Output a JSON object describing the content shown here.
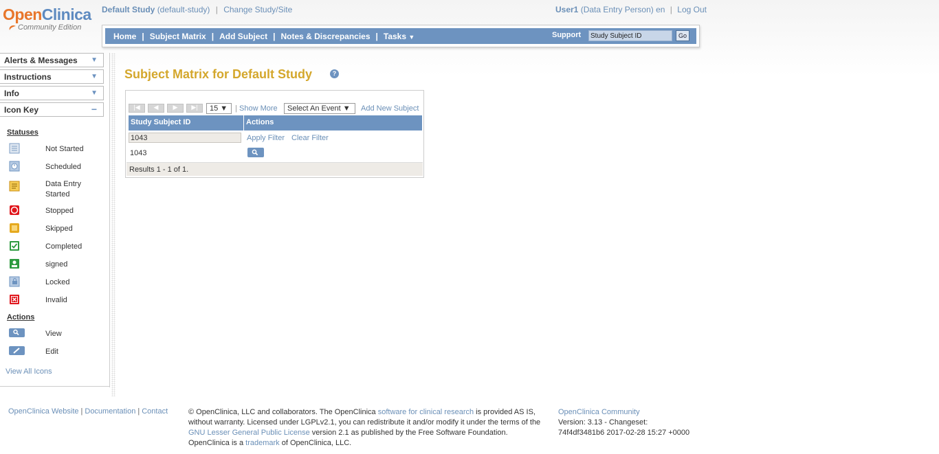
{
  "logo": {
    "part1": "Open",
    "part2": "Clinica",
    "edition": "Community Edition"
  },
  "study": {
    "name": "Default Study",
    "id": "(default-study)",
    "sep": "|",
    "change_link": "Change Study/Site"
  },
  "user": {
    "name": "User1",
    "role": "(Data Entry Person)",
    "lang": "en",
    "sep": "|",
    "logout": "Log Out"
  },
  "nav": {
    "items": [
      "Home",
      "Subject Matrix",
      "Add Subject",
      "Notes & Discrepancies",
      "Tasks"
    ],
    "sep": "|",
    "tasks_caret": "▼",
    "support": "Support",
    "search_value": "Study Subject ID",
    "go_label": "Go"
  },
  "sidebar": {
    "panels": [
      {
        "label": "Alerts & Messages",
        "state": "▼"
      },
      {
        "label": "Instructions",
        "state": "▼"
      },
      {
        "label": "Info",
        "state": "▼"
      },
      {
        "label": "Icon Key",
        "state": "−"
      }
    ],
    "statuses_heading": "Statuses",
    "statuses": [
      {
        "label": "Not Started",
        "icon": "not-started-icon",
        "color": "#7c9cc4"
      },
      {
        "label": "Scheduled",
        "icon": "scheduled-icon",
        "color": "#6d93c0"
      },
      {
        "label": "Data Entry Started",
        "icon": "data-entry-started-icon",
        "color": "#e5a91f"
      },
      {
        "label": "Stopped",
        "icon": "stopped-icon",
        "color": "#e0161c"
      },
      {
        "label": "Skipped",
        "icon": "skipped-icon",
        "color": "#e5a91f"
      },
      {
        "label": "Completed",
        "icon": "completed-icon",
        "color": "#2d9a3f"
      },
      {
        "label": "signed",
        "icon": "signed-icon",
        "color": "#2d9a3f"
      },
      {
        "label": "Locked",
        "icon": "locked-icon",
        "color": "#6d93c0"
      },
      {
        "label": "Invalid",
        "icon": "invalid-icon",
        "color": "#e0161c"
      }
    ],
    "actions_heading": "Actions",
    "actions": [
      {
        "label": "View",
        "icon": "view-icon"
      },
      {
        "label": "Edit",
        "icon": "edit-icon"
      }
    ],
    "view_all": "View All Icons"
  },
  "main": {
    "title": "Subject Matrix for Default Study",
    "help": "?",
    "page_size": "15 ▼",
    "tool_sep": "|",
    "show_more": "Show More",
    "event_select": "Select An Event ▼",
    "add_new_subject": "Add New Subject",
    "columns": [
      "Study Subject ID",
      "Actions"
    ],
    "filter_value": "1043",
    "apply_filter": "Apply Filter",
    "clear_filter": "Clear Filter",
    "rows": [
      {
        "id": "1043"
      }
    ],
    "results": "Results 1 - 1 of 1."
  },
  "footer": {
    "links": [
      "OpenClinica Website",
      "Documentation",
      "Contact"
    ],
    "sep": "|",
    "legal": {
      "t1": "© OpenClinica, LLC and collaborators. The OpenClinica ",
      "l1": "software for clinical research",
      "t2": " is provided AS IS, without warranty. Licensed under LGPLv2.1, you can redistribute it and/or modify it under the terms of the ",
      "l2": "GNU Lesser General Public License",
      "t3": " version 2.1 as published by the Free Software Foundation. OpenClinica is a ",
      "l3": "trademark",
      "t4": " of OpenClinica, LLC."
    },
    "community_link": "OpenClinica Community",
    "version": "Version: 3.13 - Changeset:",
    "changeset": "74f4df3481b6 2017-02-28 15:27 +0000"
  }
}
